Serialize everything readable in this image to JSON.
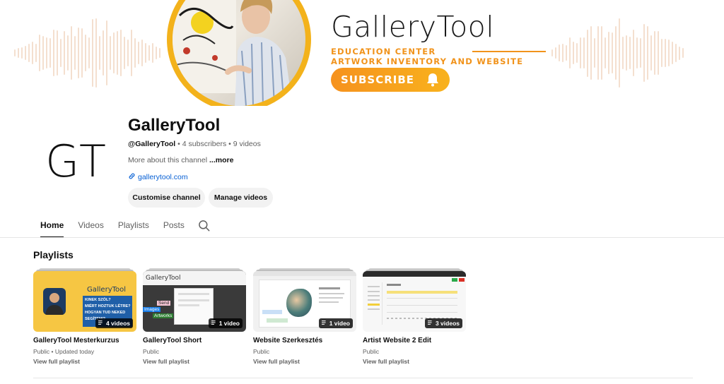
{
  "banner": {
    "brand_title": "GalleryTool",
    "subtitle_line1": "EDUCATION CENTER",
    "subtitle_line2": "ARTWORK INVENTORY AND WEBSITE",
    "subscribe_label": "SUBSCRIBE",
    "accent_color": "#f1931b"
  },
  "channel": {
    "avatar_text": "GT",
    "name": "GalleryTool",
    "handle": "@GalleryTool",
    "subscribers": "4 subscribers",
    "videos": "9 videos",
    "separator": "•",
    "about": "More about this channel",
    "more": "...more",
    "link_icon": "link-icon",
    "link": "gallerytool.com",
    "customise_label": "Customise channel",
    "manage_label": "Manage videos"
  },
  "tabs": [
    {
      "label": "Home",
      "active": true
    },
    {
      "label": "Videos",
      "active": false
    },
    {
      "label": "Playlists",
      "active": false
    },
    {
      "label": "Posts",
      "active": false
    }
  ],
  "playlists": {
    "title": "Playlists",
    "items": [
      {
        "title": "GalleryTool Mesterkurzus",
        "meta": "Public • Updated today",
        "count": "4 videos",
        "link": "View full playlist",
        "thumb_brand": "GalleryTool",
        "thumb_lines": [
          "KINEK SZÓL?",
          "MIÉRT HOZTUK LÉTRE?",
          "HOGYAN TUD NEKED",
          "SEGÍTENI?"
        ]
      },
      {
        "title": "GalleryTool Short",
        "meta": "Public",
        "count": "1 video",
        "link": "View full playlist",
        "thumb_brand": "GalleryTool",
        "thumb_tags": [
          "Send",
          "Images",
          "Artworks"
        ]
      },
      {
        "title": "Website Szerkesztés",
        "meta": "Public",
        "count": "1 video",
        "link": "View full playlist"
      },
      {
        "title": "Artist Website 2 Edit",
        "meta": "Public",
        "count": "3 videos",
        "link": "View full playlist"
      }
    ]
  }
}
